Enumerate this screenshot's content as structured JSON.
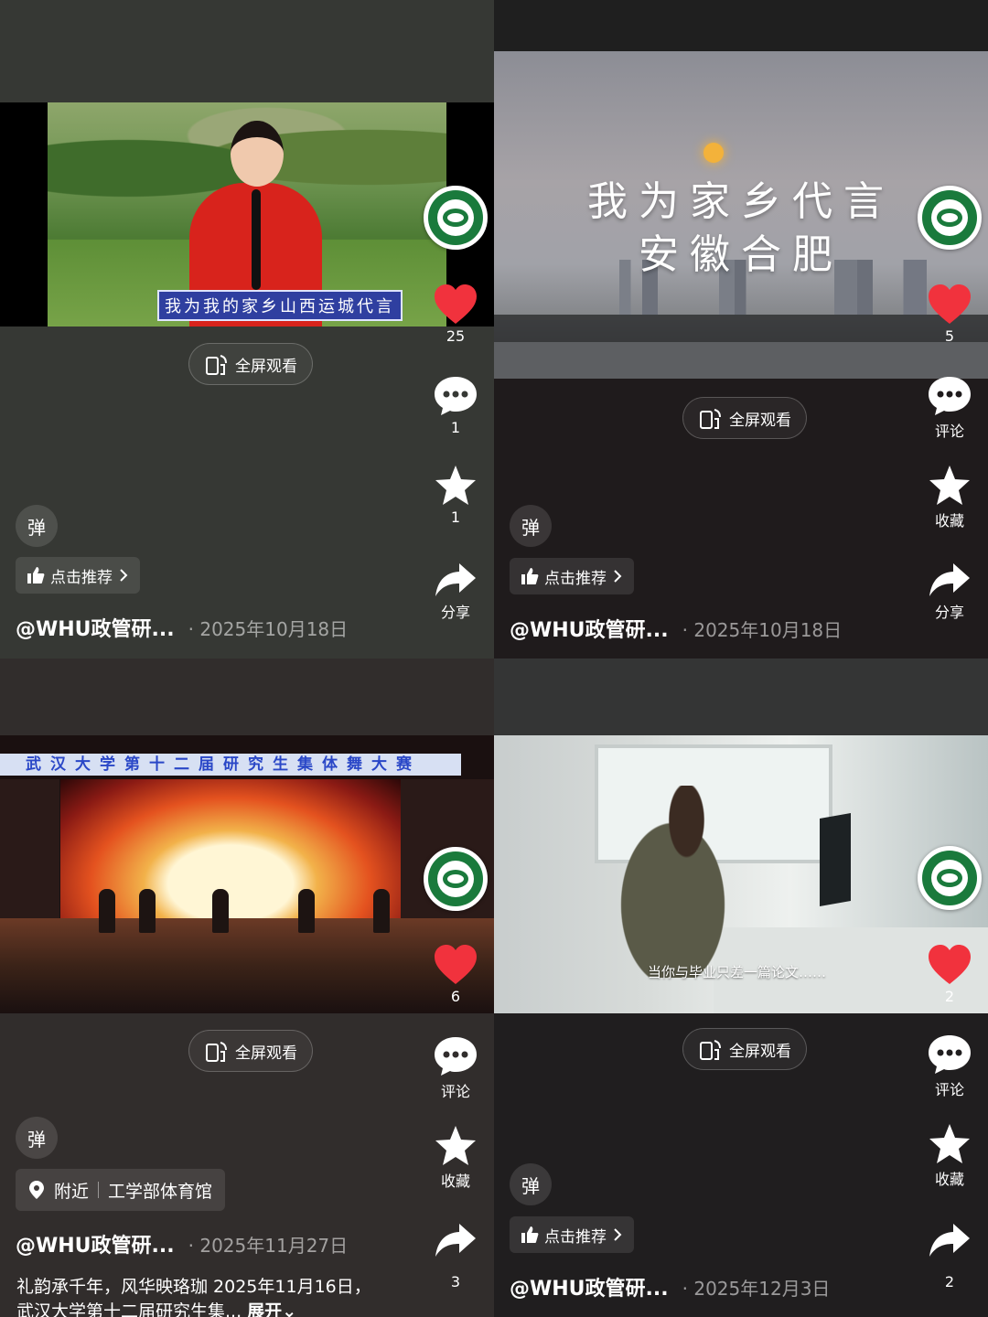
{
  "colors": {
    "like": "#f1323d",
    "fullscreen_border": "rgba(255,255,255,0.22)",
    "badge_green": "#1a7a3c"
  },
  "posts": [
    {
      "video_caption": "我为我的家乡山西运城代言",
      "like_count": "25",
      "comment_label": "1",
      "favorite_label": "1",
      "share_label": "分享",
      "fullscreen_label": "全屏观看",
      "danmu_label": "弹",
      "recommend_label": "点击推荐",
      "author": "@WHU政管研...",
      "date": "2025年10月18日"
    },
    {
      "video_title_line1": "我为家乡代言",
      "video_title_line2": "安徽合肥",
      "like_count": "5",
      "comment_label": "评论",
      "favorite_label": "收藏",
      "share_label": "分享",
      "fullscreen_label": "全屏观看",
      "danmu_label": "弹",
      "recommend_label": "点击推荐",
      "author": "@WHU政管研...",
      "date": "2025年10月18日"
    },
    {
      "video_banner": "武汉大学第十二届研究生集体舞大赛",
      "like_count": "6",
      "comment_label": "评论",
      "favorite_label": "收藏",
      "share_label": "3",
      "fullscreen_label": "全屏观看",
      "danmu_label": "弹",
      "location_prefix": "附近",
      "location_name": "工学部体育馆",
      "author": "@WHU政管研...",
      "date": "2025年11月27日",
      "description": "礼韵承千年，风华映珞珈 2025年11月16日，武汉大学第十二届研究生集...",
      "expand_label": "展开"
    },
    {
      "video_caption": "当你与毕业只差一篇论文……",
      "like_count": "2",
      "comment_label": "评论",
      "favorite_label": "收藏",
      "share_label": "2",
      "fullscreen_label": "全屏观看",
      "danmu_label": "弹",
      "recommend_label": "点击推荐",
      "author": "@WHU政管研...",
      "date": "2025年12月3日"
    }
  ],
  "icons": {
    "fullscreen": "rotate-screen-icon",
    "like": "heart-icon",
    "comment": "comment-bubble-icon",
    "favorite": "star-icon",
    "share": "share-arrow-icon",
    "recommend": "thumbs-up-icon",
    "location": "location-pin-icon",
    "chevron": "chevron-right-icon",
    "avatar": "school-badge-avatar"
  }
}
